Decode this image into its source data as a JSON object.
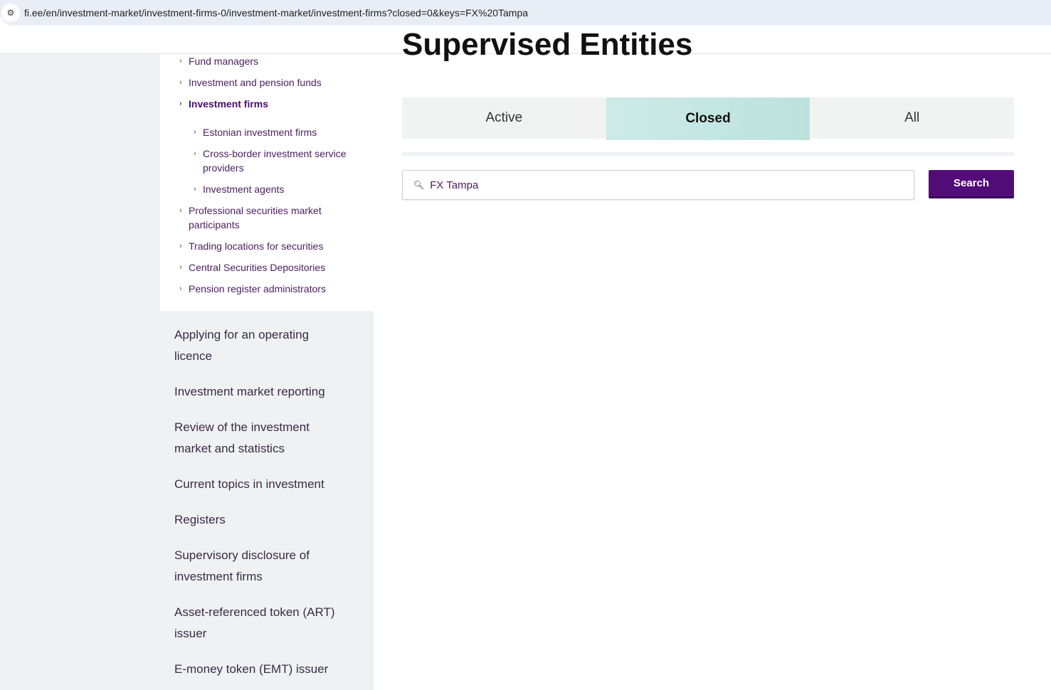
{
  "browser": {
    "url": "fi.ee/en/investment-market/investment-firms-0/investment-market/investment-firms?closed=0&keys=FX%20Tampa"
  },
  "page_title": "Supervised Entities",
  "submenu": [
    {
      "label": "Fund managers",
      "level": 1
    },
    {
      "label": "Investment and pension funds",
      "level": 1
    },
    {
      "label": "Investment firms",
      "level": 1,
      "current": true
    },
    {
      "label": "Estonian investment firms",
      "level": 2
    },
    {
      "label": "Cross-border investment service providers",
      "level": 2
    },
    {
      "label": "Investment agents",
      "level": 2
    },
    {
      "label": "Professional securities market participants",
      "level": 1
    },
    {
      "label": "Trading locations for securities",
      "level": 1
    },
    {
      "label": "Central Securities Depositories",
      "level": 1
    },
    {
      "label": "Pension register administrators",
      "level": 1
    }
  ],
  "nav": [
    "Applying for an operating licence",
    "Investment market reporting",
    "Review of the investment market and statistics",
    "Current topics in investment",
    "Registers",
    "Supervisory disclosure of investment firms",
    "Asset-referenced token (ART) issuer",
    "E-money token (EMT) issuer"
  ],
  "tabs": {
    "active": "Active",
    "closed": "Closed",
    "all": "All",
    "selected": "Closed"
  },
  "search": {
    "value": "FX Tampa",
    "button": "Search"
  }
}
